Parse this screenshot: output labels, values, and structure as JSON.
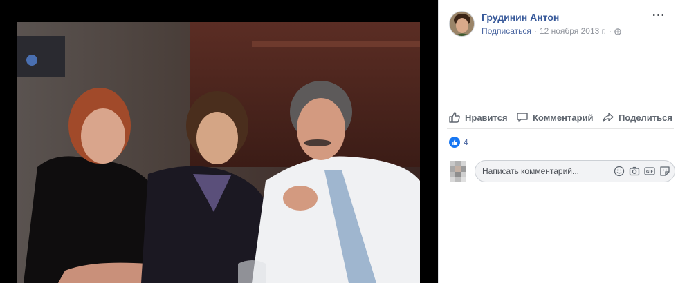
{
  "post": {
    "author": "Грудинин Антон",
    "follow_label": "Подписаться",
    "separator": "·",
    "date": "12 ноября 2013 г.",
    "audience_icon": "globe-icon",
    "more_label": "···"
  },
  "actions": {
    "like_label": "Нравится",
    "comment_label": "Комментарий",
    "share_label": "Поделиться"
  },
  "reactions": {
    "count": "4"
  },
  "comment_input": {
    "placeholder": "Написать комментарий..."
  },
  "colors": {
    "link": "#365899",
    "like_blue": "#1877f2",
    "muted": "#90949c"
  }
}
